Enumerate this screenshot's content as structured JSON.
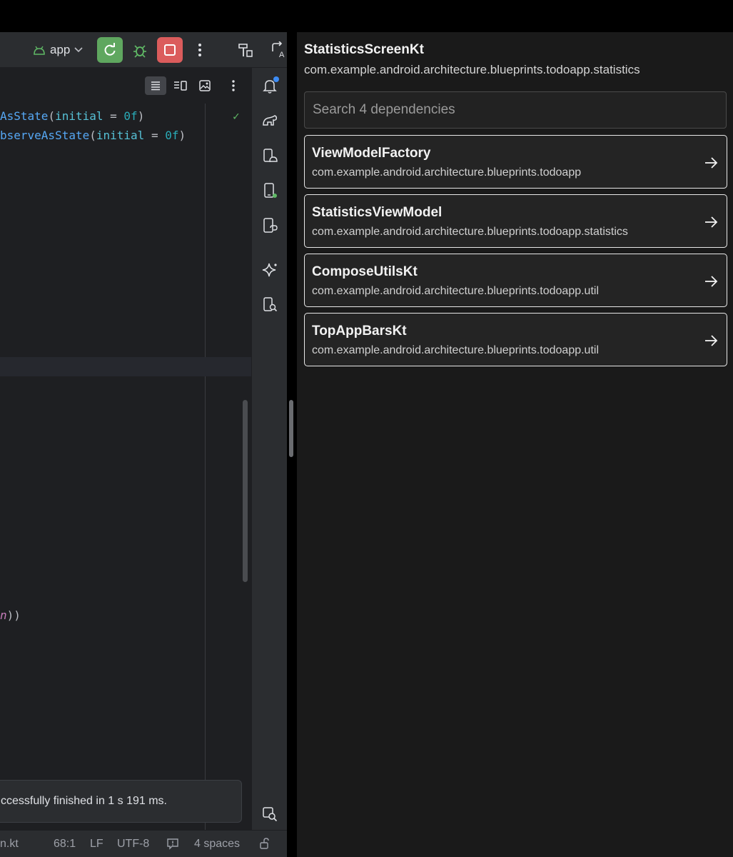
{
  "toolbar": {
    "run_config": "app"
  },
  "editor": {
    "lines": [
      {
        "pre": "",
        "fn": "AsState",
        "open": "(",
        "param": "initial",
        "eq": " = ",
        "num": "0f",
        "close": ")"
      },
      {
        "pre": "",
        "fn": "bserveAsState",
        "open": "(",
        "param": "initial",
        "eq": " = ",
        "num": "0f",
        "close": ")"
      },
      {
        "it": "n",
        "close": "))"
      }
    ]
  },
  "notification": {
    "text": "ccessfully finished in 1 s 191 ms."
  },
  "statusbar": {
    "file": "n.kt",
    "position": "68:1",
    "line_sep": "LF",
    "encoding": "UTF-8",
    "indent": "4 spaces"
  },
  "panel": {
    "title": "StatisticsScreenKt",
    "subtitle": "com.example.android.architecture.blueprints.todoapp.statistics",
    "search_placeholder": "Search 4 dependencies",
    "dependencies": [
      {
        "name": "ViewModelFactory",
        "package": "com.example.android.architecture.blueprints.todoapp"
      },
      {
        "name": "StatisticsViewModel",
        "package": "com.example.android.architecture.blueprints.todoapp.statistics"
      },
      {
        "name": "ComposeUtilsKt",
        "package": "com.example.android.architecture.blueprints.todoapp.util"
      },
      {
        "name": "TopAppBarsKt",
        "package": "com.example.android.architecture.blueprints.todoapp.util"
      }
    ]
  },
  "colors": {
    "accent_green": "#5fa75f",
    "stop_red": "#db5c5c",
    "notification_blue": "#3d8cf5"
  }
}
